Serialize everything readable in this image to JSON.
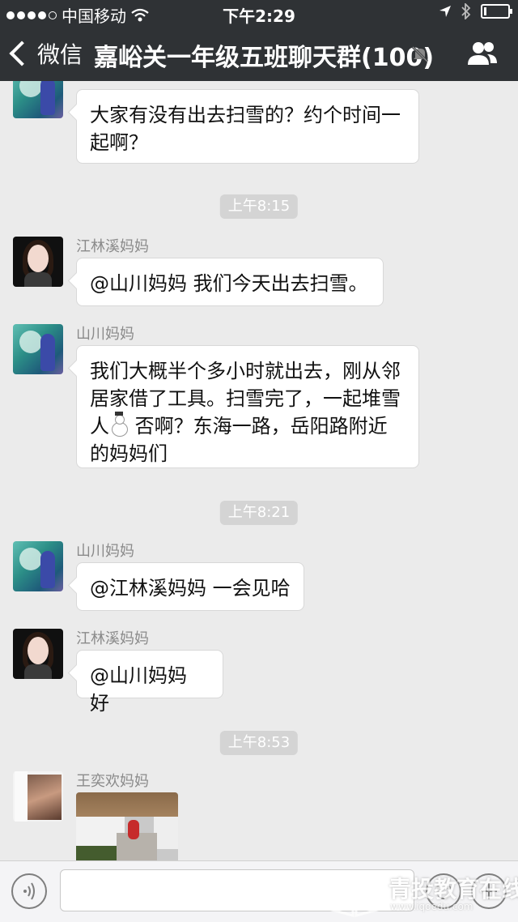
{
  "status_bar": {
    "carrier": "中国移动",
    "time": "下午2:29",
    "signal_dots": 5,
    "signal_filled": 4,
    "battery_level": 0.1
  },
  "nav": {
    "back_label": "微信",
    "title": "嘉峪关一年级五班聊天群(100)",
    "icons": [
      "chevron-left-icon",
      "mute-bell-icon",
      "group-members-icon"
    ]
  },
  "messages": {
    "m1": {
      "sender": "山川妈妈",
      "text1": "大家有没有出去扫雪的？约个时间一",
      "text2": "起啊？"
    },
    "ts1": "上午8:15",
    "m2": {
      "sender": "江林溪妈妈",
      "text": "@山川妈妈 我们今天出去扫雪。"
    },
    "m3": {
      "sender": "山川妈妈",
      "line1": "我们大概半个多小时就出去，刚从邻",
      "line2": "居家借了工具。扫雪完了，一起堆雪",
      "line3a": "人",
      "line3b": " 否啊？东海一路，岳阳路附近",
      "line4": "的妈妈们"
    },
    "ts2": "上午8:21",
    "m4": {
      "sender": "山川妈妈",
      "text": "@江林溪妈妈 一会见哈"
    },
    "m5": {
      "sender": "江林溪妈妈",
      "text": "@山川妈妈 好"
    },
    "ts3": "上午8:53",
    "m6": {
      "sender": "王奕欢妈妈"
    }
  },
  "input_bar": {
    "icons": [
      "voice-icon",
      "emoji-icon",
      "plus-icon"
    ],
    "placeholder": ""
  },
  "watermark": {
    "text": "青投教育在线",
    "url": "www.iqoedu.com"
  },
  "colors": {
    "nav_bg": "#2f3235",
    "chat_bg": "#ebebeb",
    "bubble_bg": "#ffffff",
    "timestamp_bg": "#d4d4d4"
  }
}
